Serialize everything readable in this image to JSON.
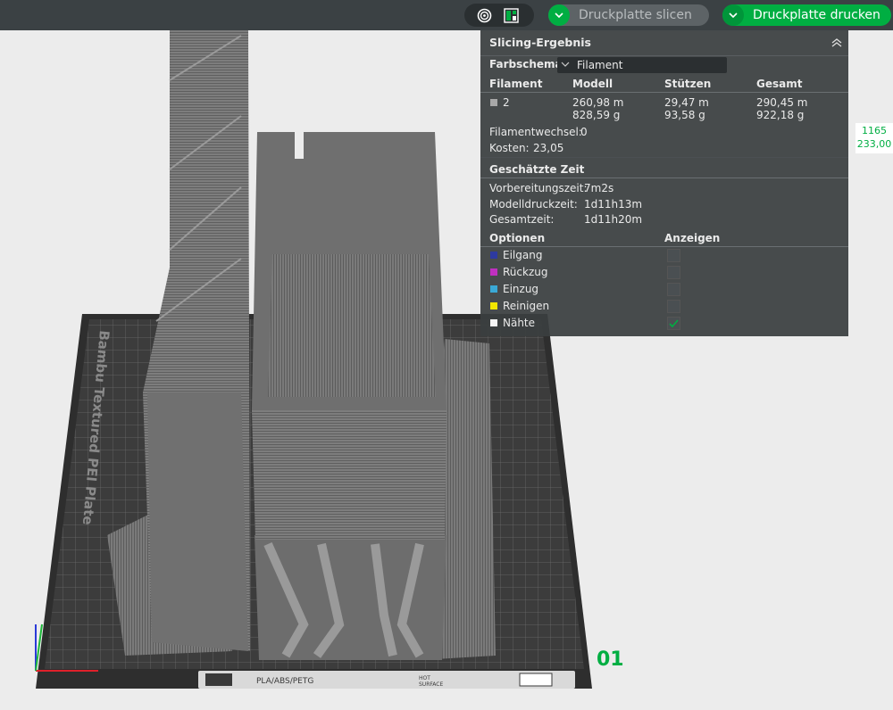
{
  "toolbar": {
    "slice_label": "Druckplatte slicen",
    "print_label": "Druckplatte drucken",
    "icons": [
      "layers-view-icon",
      "layout-view-icon",
      "chevron-down-icon"
    ],
    "colors": {
      "accent": "#00ae42",
      "toolbar_bg": "#3b4144"
    }
  },
  "panel": {
    "title": "Slicing-Ergebnis",
    "color_scheme_label": "Farbschema",
    "color_scheme_value": "Filament",
    "table": {
      "headers": [
        "Filament",
        "Modell",
        "Stützen",
        "Gesamt"
      ],
      "rows": [
        {
          "filament": "2",
          "model_length": "260,98 m",
          "model_weight": "828,59 g",
          "support_length": "29,47 m",
          "support_weight": "93,58 g",
          "total_length": "290,45 m",
          "total_weight": "922,18 g"
        }
      ]
    },
    "filament_changes_label": "Filamentwechsel:",
    "filament_changes_value": "0",
    "cost_label": "Kosten:",
    "cost_value": "23,05",
    "time_section_title": "Geschätzte Zeit",
    "prep_time_label": "Vorbereitungszeit:",
    "prep_time_value": "7m2s",
    "model_time_label": "Modelldruckzeit:",
    "model_time_value": "1d11h13m",
    "total_time_label": "Gesamtzeit:",
    "total_time_value": "1d11h20m",
    "options_header": "Optionen",
    "display_header": "Anzeigen",
    "options": [
      {
        "label": "Eilgang",
        "color": "#2e3aa0",
        "checked": false
      },
      {
        "label": "Rückzug",
        "color": "#c030c0",
        "checked": false
      },
      {
        "label": "Einzug",
        "color": "#3aa9d6",
        "checked": false
      },
      {
        "label": "Reinigen",
        "color": "#f2e600",
        "checked": false
      },
      {
        "label": "Nähte",
        "color": "#f5f5f5",
        "checked": true
      }
    ]
  },
  "readout": {
    "top": "1165",
    "bottom": "233,00"
  },
  "plate": {
    "name_text": "Bambu Textured PEI Plate",
    "number": "01",
    "label_materials": "PLA/ABS/PETG",
    "label_hot": "HOT",
    "label_surface": "SURFACE"
  }
}
